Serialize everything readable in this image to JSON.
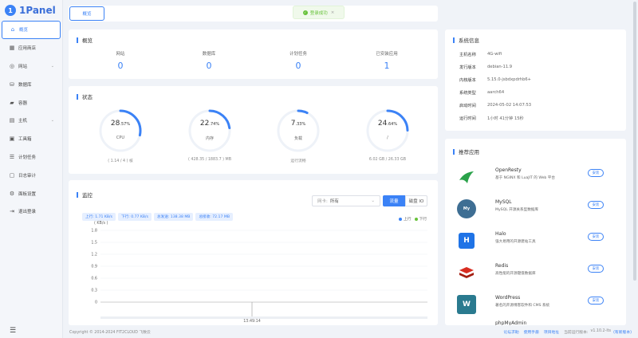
{
  "brand": {
    "name": "1Panel"
  },
  "sidebar": {
    "items": [
      {
        "label": "概览",
        "icon": "home-icon",
        "active": true
      },
      {
        "label": "应用商店",
        "icon": "appstore-icon"
      },
      {
        "label": "网站",
        "icon": "globe-icon",
        "has_children": true
      },
      {
        "label": "数据库",
        "icon": "database-icon"
      },
      {
        "label": "容器",
        "icon": "container-icon"
      },
      {
        "label": "主机",
        "icon": "host-icon",
        "has_children": true
      },
      {
        "label": "工具箱",
        "icon": "toolbox-icon"
      },
      {
        "label": "计划任务",
        "icon": "cron-icon"
      },
      {
        "label": "日志审计",
        "icon": "log-icon"
      },
      {
        "label": "面板设置",
        "icon": "gear-icon"
      },
      {
        "label": "退出登录",
        "icon": "logout-icon"
      }
    ]
  },
  "header": {
    "tab": "概览"
  },
  "toast": {
    "text": "登录成功",
    "close": "×"
  },
  "overview": {
    "title": "概览",
    "items": [
      {
        "label": "网站",
        "value": "0"
      },
      {
        "label": "数据库",
        "value": "0"
      },
      {
        "label": "计划任务",
        "value": "0"
      },
      {
        "label": "已安装应用",
        "value": "1"
      }
    ]
  },
  "status": {
    "title": "状态",
    "gauges": [
      {
        "int": "28",
        "dec": ".57",
        "unit": "%",
        "name": "CPU",
        "detail": "( 1.14 / 4 ) 核",
        "percent": 28.57
      },
      {
        "int": "22",
        "dec": ".74",
        "unit": "%",
        "name": "内存",
        "detail": "( 428.35 / 1883.7 ) MB",
        "percent": 22.74
      },
      {
        "int": "7",
        "dec": ".33",
        "unit": "%",
        "name": "负载",
        "detail": "运行流畅",
        "percent": 7.33
      },
      {
        "int": "24",
        "dec": ".64",
        "unit": "%",
        "name": "/",
        "detail": "6.02 GB / 26.33 GB",
        "percent": 24.64
      }
    ]
  },
  "monitor": {
    "title": "监控",
    "select_prefix": "网卡:",
    "select_value": "所有",
    "btn_flow": "流量",
    "btn_io": "磁盘 IO",
    "chips": [
      "上行: 1.71 KB/s",
      "下行: 0.77 KB/s",
      "总发送: 138.38 MB",
      "总接收: 72.17 MB"
    ],
    "legend_up": "上行",
    "legend_down": "下行"
  },
  "chart_data": {
    "type": "line",
    "ylabel": "( KB/s )",
    "yticks": [
      "1.8",
      "1.5",
      "1.2",
      "0.9",
      "0.6",
      "0.3",
      "0"
    ],
    "ylim": [
      0,
      1.8
    ],
    "x": [
      "13:49:14"
    ],
    "series": [
      {
        "name": "上行",
        "values": [
          0
        ]
      },
      {
        "name": "下行",
        "values": [
          0
        ]
      }
    ],
    "colors": {
      "up": "#3b82f6",
      "down": "#67c23a"
    },
    "grid": true
  },
  "sysinfo": {
    "title": "系统信息",
    "rows": [
      {
        "k": "主机名称",
        "v": "4G-wifi"
      },
      {
        "k": "发行版本",
        "v": "debian-11.9"
      },
      {
        "k": "内核版本",
        "v": "5.15.0-jsbdxpdrhb6+"
      },
      {
        "k": "系统类型",
        "v": "aarch64"
      },
      {
        "k": "启动时间",
        "v": "2024-05-02 14:07:53"
      },
      {
        "k": "运行时间",
        "v": "1小时 41分钟 15秒"
      }
    ]
  },
  "apps": {
    "title": "推荐应用",
    "install_label": "安装",
    "items": [
      {
        "name": "OpenResty",
        "desc": "基于 NGINX 和 LuaJIT 的 Web 平台",
        "icon": "openresty-icon",
        "color": "#ffffff"
      },
      {
        "name": "MySQL",
        "desc": "MySQL 开源关系型数据库",
        "icon": "mysql-icon",
        "color": "#3e6e93"
      },
      {
        "name": "Halo",
        "desc": "强大易用的开源建站工具",
        "icon": "halo-icon",
        "color": "#1f73e6"
      },
      {
        "name": "Redis",
        "desc": "高性能的开源键值数据库",
        "icon": "redis-icon",
        "color": "#d82c20"
      },
      {
        "name": "WordPress",
        "desc": "著名的开源博客软件和 CMS 系统",
        "icon": "wordpress-icon",
        "color": "#2a7a8f"
      }
    ],
    "partial": "phpMyAdmin"
  },
  "footer": {
    "copyright": "Copyright © 2014-2024 FIT2CLOUD 飞致云",
    "forum": "论坛求助",
    "manual": "使用手册",
    "project": "项目地址",
    "version_label": "当前运行版本:",
    "version": "v1.10.2-lts",
    "update": "(有新版本)"
  }
}
